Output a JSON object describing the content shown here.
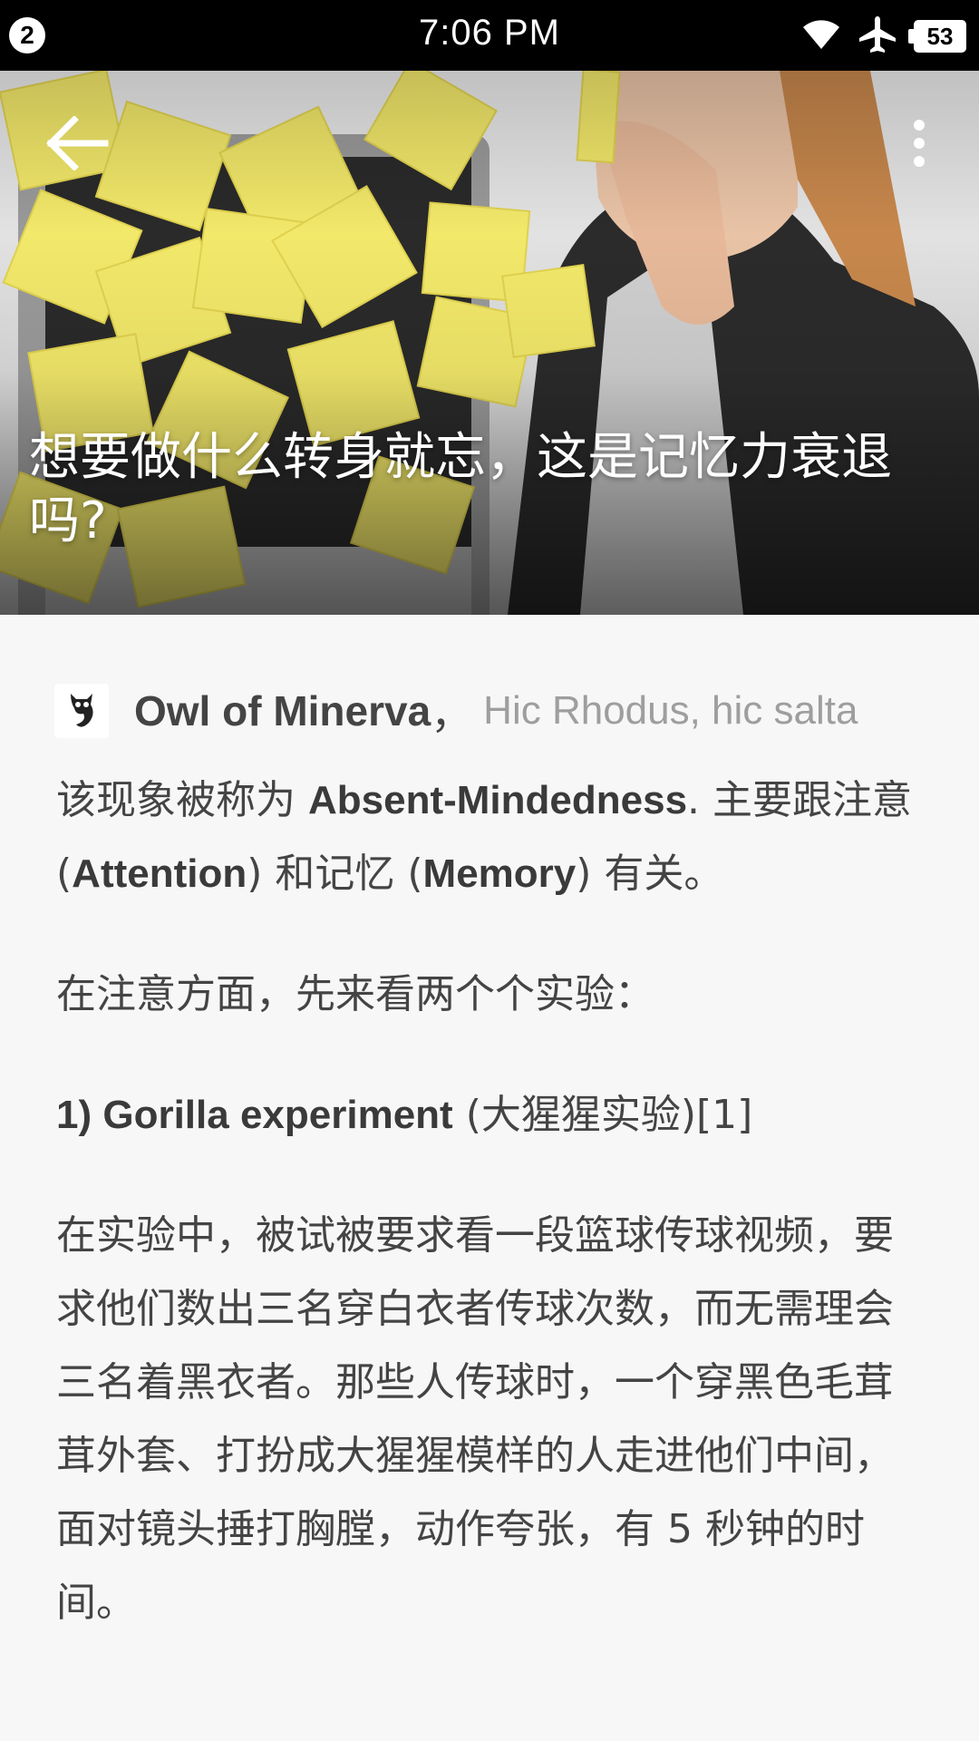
{
  "status_bar": {
    "notification_count": "2",
    "time": "7:06 PM",
    "battery": "53",
    "icons": [
      "wifi-icon",
      "airplane-icon",
      "battery-icon"
    ]
  },
  "toolbar": {
    "back_icon": "arrow-back-icon",
    "more_icon": "more-vertical-icon"
  },
  "hero": {
    "title": "想要做什么转身就忘，这是记忆力衰退吗?"
  },
  "author": {
    "name": "Owl of Minerva",
    "separator": "，",
    "bio": "Hic Rhodus, hic salta"
  },
  "article": {
    "p1": {
      "t1": "该现象被称为 ",
      "b1": "Absent-Mindedness",
      "t2": ". 主要跟注意 (",
      "b2": "Attention",
      "t3": ") 和记忆 (",
      "b3": "Memory",
      "t4": ") 有关。"
    },
    "p2": "在注意方面，先来看两个个实验：",
    "p3": {
      "bold": "1) Gorilla experiment",
      "rest": " (大猩猩实验)[1]"
    },
    "p4": "在实验中，被试被要求看一段篮球传球视频，要求他们数出三名穿白衣者传球次数，而无需理会三名着黑衣者。那些人传球时，一个穿黑色毛茸茸外套、打扮成大猩猩模样的人走进他们中间，面对镜头捶打胸膛，动作夸张，有 5 秒钟的时间。"
  },
  "colors": {
    "status_bar": "#000000",
    "background": "#f7f7f7",
    "text": "#444444",
    "bio": "#9e9e9e",
    "sticky_note": "#f2e86a"
  }
}
